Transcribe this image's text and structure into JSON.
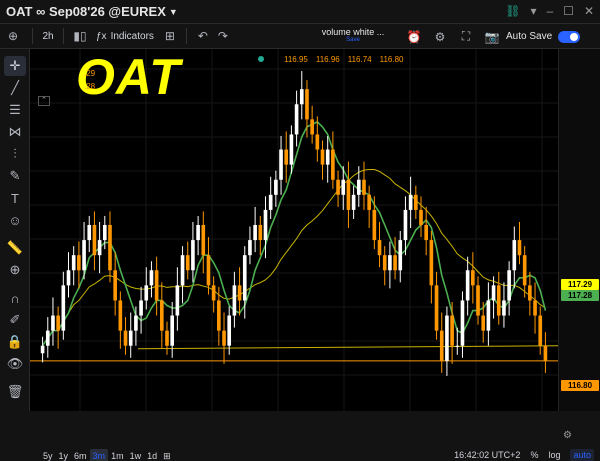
{
  "header": {
    "symbol": "OAT ∞ Sep08'26 @EUREX",
    "icons": [
      "link-icon",
      "chevron-down-icon",
      "minimize-icon",
      "maximize-icon",
      "close-icon"
    ]
  },
  "toolbar": {
    "interval": "2h",
    "indicators_label": "Indicators",
    "layout_name": "volume white ...",
    "layout_status": "Save",
    "autosave_label": "Auto Save"
  },
  "overlay": {
    "title": "OAT",
    "legend_small_1": ".29",
    "legend_small_2": ".28",
    "legend_values": [
      "116.95",
      "116.96",
      "116.74",
      "116.80"
    ]
  },
  "price_axis": {
    "tags": [
      {
        "value": "117.29",
        "color": "#ffff00"
      },
      {
        "value": "117.28",
        "color": "#4caf50"
      },
      {
        "value": "116.80",
        "color": "#ff9800"
      }
    ]
  },
  "bottom": {
    "timeframes": [
      "5y",
      "1y",
      "6m",
      "3m",
      "1m",
      "1w",
      "1d"
    ],
    "active_timeframe": "3m",
    "clock": "16:42:02 UTC+2",
    "percent": "%",
    "log": "log",
    "auto": "auto"
  },
  "chart_data": {
    "type": "candlestick",
    "candles_close_trend": [
      116.9,
      117.0,
      117.1,
      117.0,
      117.3,
      117.4,
      117.5,
      117.4,
      117.6,
      117.7,
      117.5,
      117.6,
      117.7,
      117.4,
      117.2,
      117.0,
      116.9,
      117.0,
      117.1,
      117.2,
      117.3,
      117.4,
      117.2,
      117.0,
      116.9,
      117.1,
      117.3,
      117.5,
      117.4,
      117.6,
      117.7,
      117.5,
      117.3,
      117.2,
      117.0,
      116.9,
      117.1,
      117.3,
      117.2,
      117.5,
      117.6,
      117.7,
      117.6,
      117.8,
      117.9,
      118.0,
      118.2,
      118.1,
      118.3,
      118.5,
      118.6,
      118.4,
      118.3,
      118.2,
      118.1,
      118.2,
      118.0,
      117.9,
      118.0,
      117.8,
      117.9,
      118.0,
      117.9,
      117.8,
      117.6,
      117.5,
      117.4,
      117.5,
      117.4,
      117.6,
      117.8,
      117.9,
      117.8,
      117.7,
      117.6,
      117.3,
      117.0,
      116.8,
      117.1,
      116.9,
      116.9,
      117.2,
      117.4,
      117.3,
      117.1,
      117.0,
      117.2,
      117.3,
      117.1,
      117.2,
      117.4,
      117.6,
      117.5,
      117.3,
      117.2,
      117.1,
      116.9,
      116.8
    ],
    "series": [
      {
        "name": "",
        "color": "#4caf50",
        "kind": "moving-average-fast"
      },
      {
        "name": "",
        "color": "#c8b400",
        "kind": "moving-average-slow"
      }
    ],
    "horizontal_lines": [
      116.8
    ],
    "last_price": 116.8
  }
}
